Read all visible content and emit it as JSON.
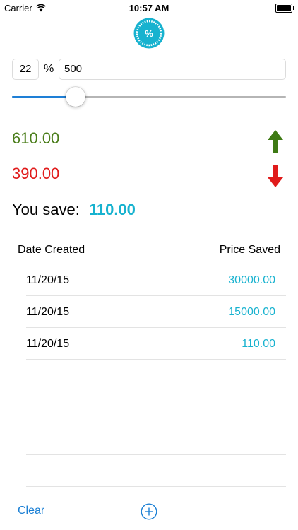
{
  "status_bar": {
    "carrier": "Carrier",
    "time": "10:57 AM",
    "wifi_icon": "wifi-icon",
    "battery_icon": "battery-icon"
  },
  "logo": {
    "icon": "percent-badge-icon",
    "symbol": "%",
    "color": "#17b2cf"
  },
  "inputs": {
    "percent_value": "22",
    "percent_sign": "%",
    "price_value": "500"
  },
  "slider": {
    "value_fraction": 0.233,
    "fill_color": "#1e7fd6"
  },
  "results": {
    "increased": "610.00",
    "increased_color": "#4a7d1a",
    "up_icon": "arrow-up-icon",
    "decreased": "390.00",
    "decreased_color": "#e01b1b",
    "down_icon": "arrow-down-icon",
    "save_label": "You save:",
    "save_value": "110.00",
    "save_color": "#17b2cf"
  },
  "table": {
    "headers": {
      "date": "Date Created",
      "price": "Price Saved"
    },
    "rows": [
      {
        "date": "11/20/15",
        "price": "30000.00"
      },
      {
        "date": "11/20/15",
        "price": "15000.00"
      },
      {
        "date": "11/20/15",
        "price": "110.00"
      }
    ]
  },
  "toolbar": {
    "clear_label": "Clear",
    "add_icon": "plus-circle-icon",
    "accent": "#1a7fd4"
  }
}
